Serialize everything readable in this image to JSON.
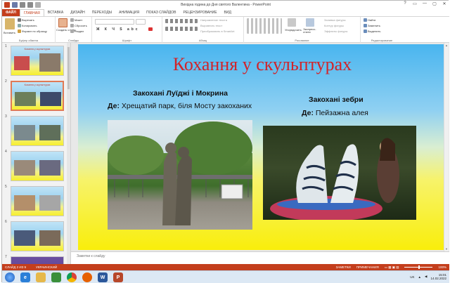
{
  "window": {
    "title": "Вихідна година до Дня святого Валентина - PowerPoint",
    "controls": [
      "?",
      "▭",
      "—",
      "▢",
      "✕"
    ]
  },
  "ribbon_tabs": [
    "ФАЙЛ",
    "ГЛАВНАЯ",
    "ВСТАВКА",
    "ДИЗАЙН",
    "ПЕРЕХОДЫ",
    "АНИМАЦИЯ",
    "ПОКАЗ СЛАЙДОВ",
    "РЕЦЕНЗИРОВАНИЕ",
    "ВИД"
  ],
  "ribbon": {
    "clipboard": {
      "label": "Буфер обмена",
      "paste": "Вставить",
      "cut": "Вырезать",
      "copy": "Копировать",
      "format": "Формат по образцу"
    },
    "slides": {
      "label": "Слайды",
      "create": "Создать слайд",
      "layout": "Макет",
      "reset": "Сбросить",
      "section": "Раздел"
    },
    "font": {
      "label": "Шрифт"
    },
    "paragraph": {
      "label": "Абзац",
      "dir": "Направление текста",
      "align": "Выровнять текст",
      "smartart": "Преобразовать в SmartArt"
    },
    "drawing": {
      "label": "Рисование",
      "arrange": "Упорядочить",
      "quick": "Экспресс-стили",
      "fill": "Заливка фигуры",
      "outline": "Контур фигуры",
      "effects": "Эффекты фигуры"
    },
    "editing": {
      "label": "Редактирование",
      "find": "Найти",
      "replace": "Заменить",
      "select": "Выделить"
    }
  },
  "thumbnails": [
    {
      "num": "1",
      "title": "Кохання у скульптурах"
    },
    {
      "num": "2",
      "title": "Кохання у скульптурах"
    },
    {
      "num": "3",
      "title": ""
    },
    {
      "num": "4",
      "title": ""
    },
    {
      "num": "5",
      "title": ""
    },
    {
      "num": "6",
      "title": ""
    },
    {
      "num": "7",
      "title": ""
    }
  ],
  "slide": {
    "title": "Кохання у скульптурах",
    "left": {
      "heading": "Закохані Луїджі і Мокрина",
      "where_label": "Де:",
      "where_value": "Хрещатий парк, біля Мосту закоханих"
    },
    "right": {
      "heading": "Закохані зебри",
      "where_label": "Де:",
      "where_value": "Пейзажна алея"
    }
  },
  "notes_placeholder": "Заметки к слайду",
  "status": {
    "slide_counter": "СЛАЙД 2 ИЗ 9",
    "language": "УКРАИНСКИЙ",
    "notes": "ЗАМЕТКИ",
    "comments": "ПРИМЕЧАНИЯ",
    "zoom": "100%"
  },
  "taskbar": {
    "lang": "UK",
    "time": "15:01",
    "date": "14.02.2022"
  },
  "colors": {
    "accent": "#c43e1c",
    "slide_title": "#d1242a"
  }
}
